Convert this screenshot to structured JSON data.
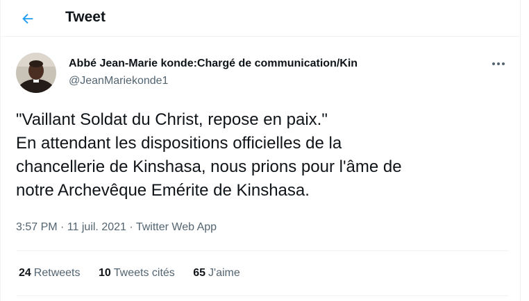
{
  "header": {
    "title": "Tweet",
    "back_icon": "arrow-left-icon"
  },
  "author": {
    "display_name": "Abbé Jean-Marie konde:Chargé de communication/Kin",
    "handle": "@JeanMariekonde1"
  },
  "tweet": {
    "lines": [
      "\"Vaillant Soldat du Christ, repose en paix.\"",
      "En attendant les dispositions officielles de la",
      "chancellerie de Kinshasa, nous prions pour l'âme de",
      "notre Archevêque Emérite de Kinshasa."
    ]
  },
  "meta": {
    "time": "3:57 PM",
    "separator": " · ",
    "date": "11 juil. 2021",
    "source": "Twitter Web App"
  },
  "stats": {
    "retweets_count": "24",
    "retweets_label": "Retweets",
    "quotes_count": "10",
    "quotes_label": "Tweets cités",
    "likes_count": "65",
    "likes_label": "J'aime"
  },
  "colors": {
    "accent": "#1d9bf0",
    "text_primary": "#0f1419",
    "text_secondary": "#536471",
    "divider": "#eff3f4"
  }
}
